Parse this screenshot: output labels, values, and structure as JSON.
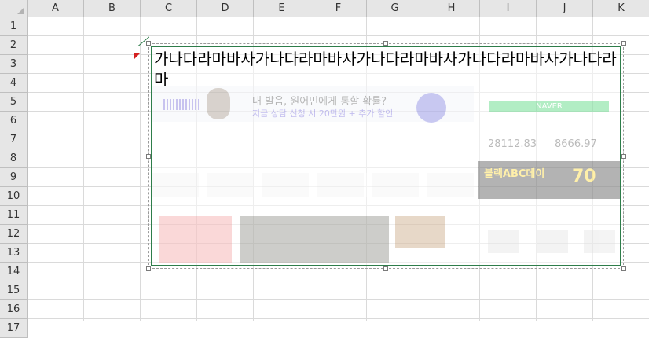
{
  "columns": [
    "A",
    "B",
    "C",
    "D",
    "E",
    "F",
    "G",
    "H",
    "I",
    "J",
    "K"
  ],
  "rows": [
    "1",
    "2",
    "3",
    "4",
    "5",
    "6",
    "7",
    "8",
    "9",
    "10",
    "11",
    "12",
    "13",
    "14",
    "15",
    "16",
    "17"
  ],
  "comment": {
    "text": "가나다라마바사가나다라마바사가나다라마바사가나다라마바사가나다라마",
    "border_color": "#2e7d4a",
    "marker_color": "#d42020"
  },
  "ghost_image": {
    "banner_headline": "내 발음, 원어민에게 통할 확률?",
    "banner_sub": "지금 상담 신청 시 20만원 + 추가 할인",
    "green_button": "NAVER",
    "stock_left": "28112.83",
    "stock_right": "8666.97",
    "ad_text": "블랙ABC데이",
    "ad_badge": "70"
  }
}
